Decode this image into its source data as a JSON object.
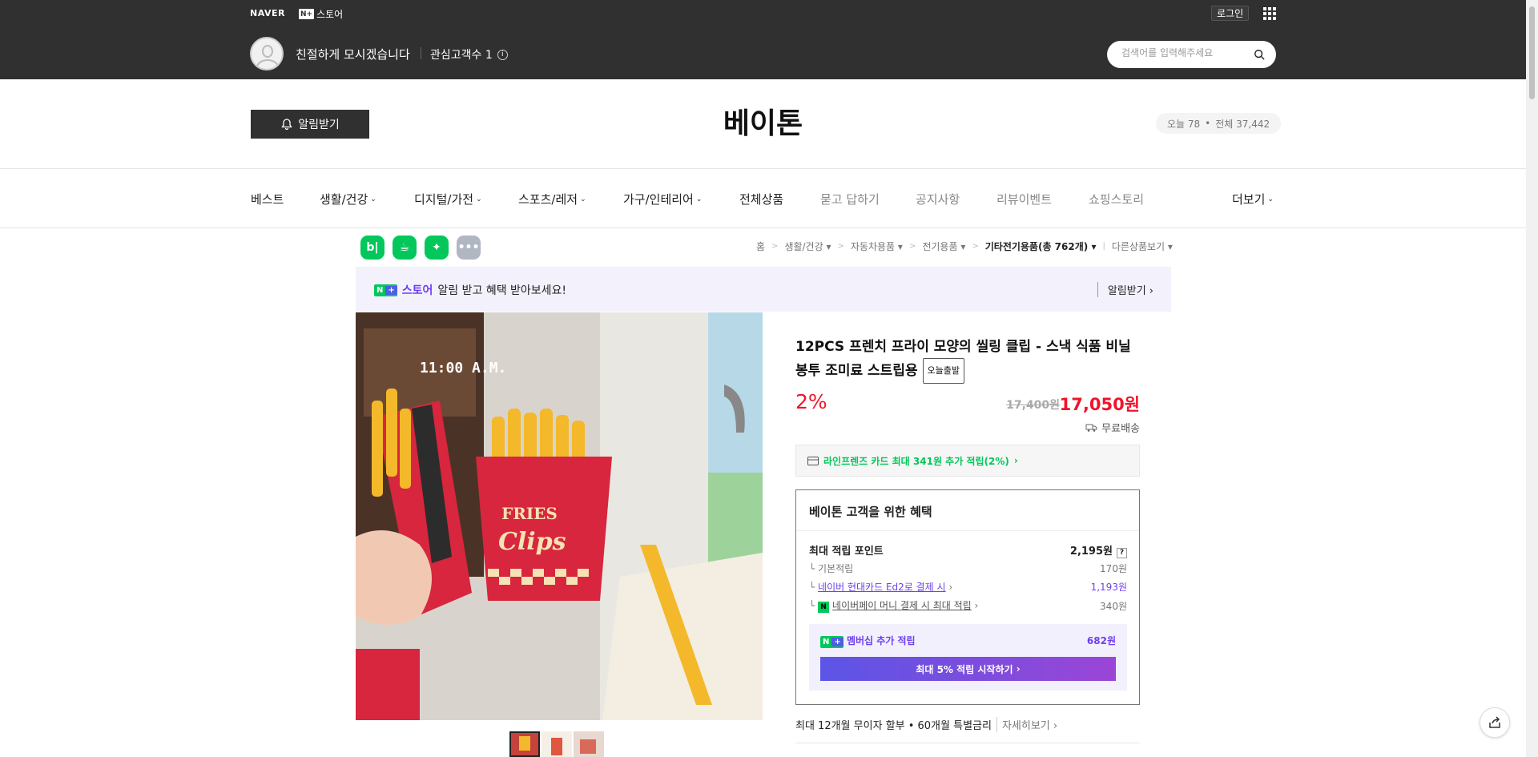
{
  "topbar": {
    "naver_logo": "NAVER",
    "store_badge": "N+",
    "store_label": "스토어",
    "login_label": "로그인",
    "greeting": "친절하게 모시겠습니다",
    "followers_label": "관심고객수 1",
    "search_placeholder": "검색어를 입력해주세요"
  },
  "shop": {
    "alarm_label": "알림받기",
    "title": "베이톤",
    "today_label": "오늘 78",
    "total_label": "전체 37,442"
  },
  "nav": {
    "items": [
      {
        "label": "베스트",
        "chevron": false,
        "gray": false
      },
      {
        "label": "생활/건강",
        "chevron": true,
        "gray": false
      },
      {
        "label": "디지털/가전",
        "chevron": true,
        "gray": false
      },
      {
        "label": "스포츠/레저",
        "chevron": true,
        "gray": false
      },
      {
        "label": "가구/인테리어",
        "chevron": true,
        "gray": false
      },
      {
        "label": "전체상품",
        "chevron": false,
        "gray": false
      },
      {
        "label": "묻고 답하기",
        "chevron": false,
        "gray": true
      },
      {
        "label": "공지사항",
        "chevron": false,
        "gray": true
      },
      {
        "label": "리뷰이벤트",
        "chevron": false,
        "gray": true
      },
      {
        "label": "쇼핑스토리",
        "chevron": false,
        "gray": true
      }
    ],
    "more_label": "더보기"
  },
  "breadcrumb": {
    "items": [
      "홈",
      "생활/건강",
      "자동차용품",
      "전기용품",
      "기타전기용품(총 762개)",
      "다른상품보기"
    ]
  },
  "banner": {
    "store_word": "스토어",
    "message": "알림 받고 혜택 받아보세요!",
    "action": "알림받기"
  },
  "product": {
    "title": "12PCS 프렌치 프라이 모양의 씰링 클립 - 스낵 식품 비닐 봉투 조미료 스트립용",
    "tag": "오늘출발",
    "discount": "2%",
    "original_price": "17,400원",
    "sale_price": "17,050원",
    "shipping": "무료배송",
    "card_benefit": "라인프렌즈 카드 최대 341원 추가 적립(2%)",
    "image_text_time": "11:00 A.M.",
    "image_text_fries": "FRIES",
    "image_text_clips": "Clips"
  },
  "benefit": {
    "title": "베이톤 고객을 위한 혜택",
    "max_point_label": "최대 적립 포인트",
    "max_point_value": "2,195원",
    "base_label": "기본적립",
    "base_value": "170원",
    "card_label": "네이버 현대카드 Ed2로 결제 시",
    "card_value": "1,193원",
    "pay_label": "네이버페이 머니 결제 시 최대 적립",
    "pay_value": "340원",
    "membership_label": "멤버십 추가 적립",
    "membership_value": "682원",
    "membership_button": "최대 5% 적립 시작하기"
  },
  "installment": {
    "text": "최대 12개월 무이자 할부 • 60개월 특별금리",
    "more": "자세히보기"
  },
  "colors": {
    "topbar": "#303030",
    "naver_green": "#03c75a",
    "sale_red": "#f1132a",
    "accent_purple": "#6e3ff0"
  }
}
